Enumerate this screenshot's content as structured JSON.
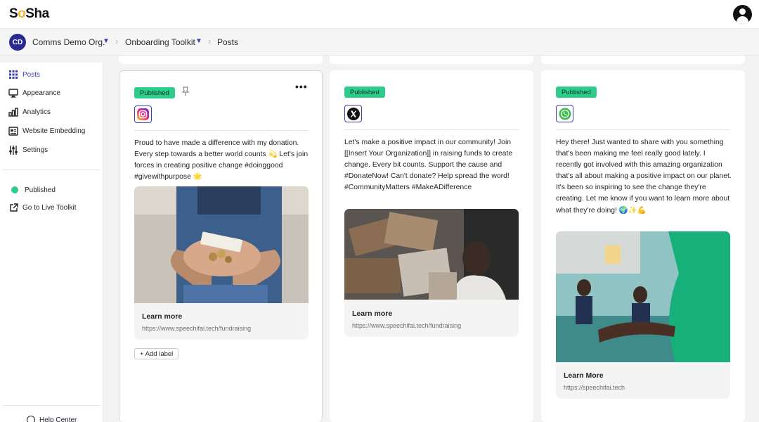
{
  "app": {
    "logo_prefix": "S",
    "logo_mid": "o",
    "logo_suffix": "Sha"
  },
  "breadcrumb": {
    "org_initials": "CD",
    "org_name": "Comms Demo Org.",
    "toolkit": "Onboarding Toolkit",
    "page": "Posts"
  },
  "sidebar": {
    "items": [
      {
        "label": "Posts",
        "icon": "grid-icon"
      },
      {
        "label": "Appearance",
        "icon": "monitor-icon"
      },
      {
        "label": "Analytics",
        "icon": "bar-chart-icon"
      },
      {
        "label": "Website Embedding",
        "icon": "embed-icon"
      },
      {
        "label": "Settings",
        "icon": "sliders-icon"
      }
    ],
    "status": "Published",
    "live_link": "Go to Live Toolkit",
    "help": "Help Center"
  },
  "colors": {
    "accent": "#3b3fb0",
    "published": "#2ecc8b"
  },
  "posts": [
    {
      "status": "Published",
      "platform": "instagram-icon",
      "text": "Proud to have made a difference with my donation. Every step towards a better world counts 💫 Let's join forces in creating positive change #doinggood #givewithpurpose 🌟",
      "link_title": "Learn more",
      "link_url": "https://www.speechifai.tech/fundraising",
      "add_label": "+ Add label"
    },
    {
      "status": "Published",
      "platform": "x-icon",
      "text": "Let's make a positive impact in our community! Join [[Insert Your Organization]] in raising funds to create change. Every bit counts. Support the cause and #DonateNow! Can't donate? Help spread the word! #CommunityMatters #MakeADifference",
      "link_title": "Learn more",
      "link_url": "https://www.speechifai.tech/fundraising"
    },
    {
      "status": "Published",
      "platform": "whatsapp-icon",
      "text": "Hey there! Just wanted to share with you something that's been making me feel really good lately. I recently got involved with this amazing organization that's all about making a positive impact on our planet. It's been so inspiring to see the change they're creating. Let me know if you want to learn more about what they're doing! 🌍✨💪",
      "link_title": "Learn More",
      "link_url": "https://speechifai.tech"
    }
  ]
}
